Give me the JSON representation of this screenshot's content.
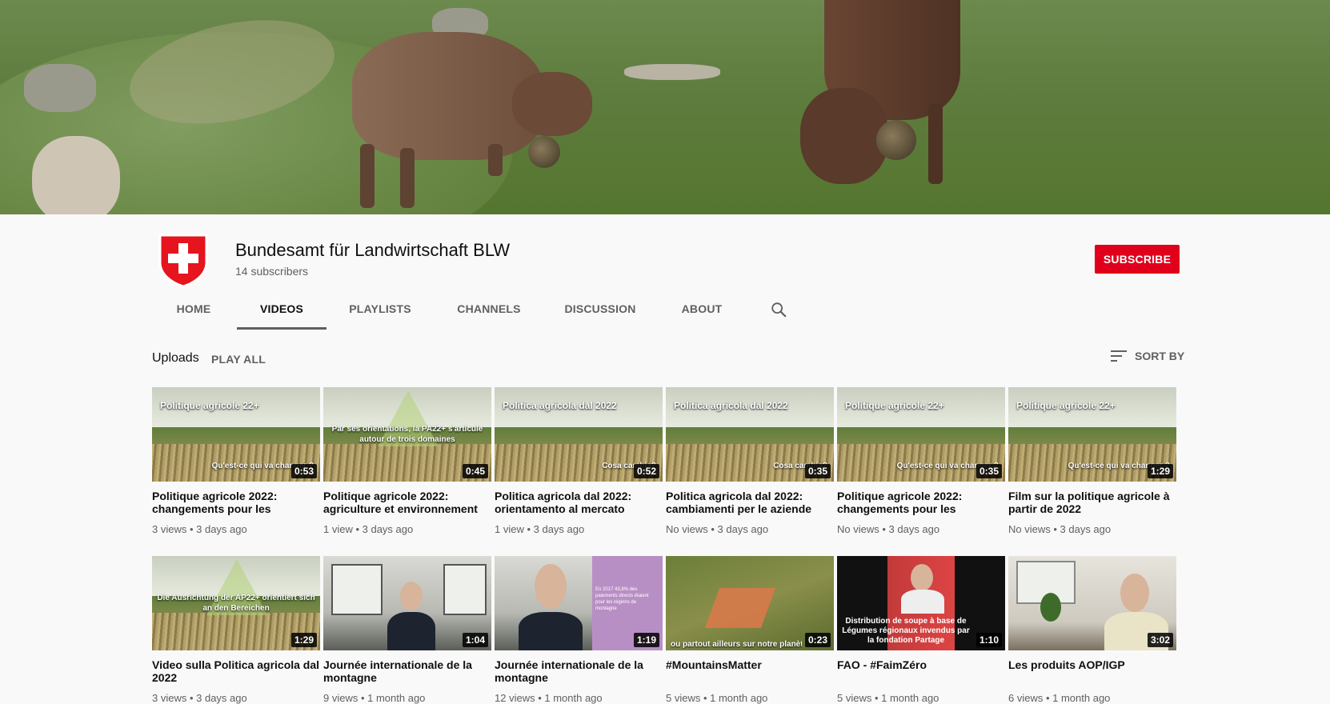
{
  "channel": {
    "name": "Bundesamt für Landwirtschaft BLW",
    "subscribers": "14 subscribers",
    "subscribe_label": "SUBSCRIBE",
    "accent_color": "#e0001b"
  },
  "tabs": [
    "HOME",
    "VIDEOS",
    "PLAYLISTS",
    "CHANNELS",
    "DISCUSSION",
    "ABOUT"
  ],
  "active_tab": "VIDEOS",
  "section": {
    "title": "Uploads",
    "play_all": "PLAY ALL",
    "sort_by": "SORT BY"
  },
  "videos": [
    {
      "title": "Politique agricole 2022: changements pour les",
      "meta": "3 views • 3 days ago",
      "duration": "0:53",
      "overlay_top": "Politique agricole 22+",
      "overlay_bottom": "Qu'est-ce qui va changer ?"
    },
    {
      "title": "Politique agricole 2022: agriculture et environnement",
      "meta": "1 view • 3 days ago",
      "duration": "0:45",
      "overlay_center": "Par ses orientations, la PA22+ s'articule autour de trois domaines"
    },
    {
      "title": "Politica agricola dal 2022: orientamento al mercato",
      "meta": "1 view • 3 days ago",
      "duration": "0:52",
      "overlay_top": "Politica agricola dal 2022",
      "overlay_bottom": "Cosa cambia?"
    },
    {
      "title": "Politica agricola dal 2022: cambiamenti per le aziende",
      "meta": "No views • 3 days ago",
      "duration": "0:35",
      "overlay_top": "Politica agricola dal 2022",
      "overlay_bottom": "Cosa cambia?"
    },
    {
      "title": "Politique agricole 2022: changements pour les",
      "meta": "No views • 3 days ago",
      "duration": "0:35",
      "overlay_top": "Politique agricole 22+",
      "overlay_bottom": "Qu'est-ce qui va changer ?"
    },
    {
      "title": "Film sur la politique agricole à partir de 2022",
      "meta": "No views • 3 days ago",
      "duration": "1:29",
      "overlay_top": "Politique agricole 22+",
      "overlay_bottom": "Qu'est-ce qui va changer ?"
    },
    {
      "title": "Video sulla Politica agricola dal 2022",
      "meta": "3 views • 3 days ago",
      "duration": "1:29",
      "overlay_center": "Die Ausrichtung der AP22+ orientiert sich an den Bereichen"
    },
    {
      "title": "Journée internationale de la montagne",
      "meta": "9 views • 1 month ago",
      "duration": "1:04"
    },
    {
      "title": "Journée internationale de la montagne",
      "meta": "12 views • 1 month ago",
      "duration": "1:19",
      "overlay_side": "En 2017 43,8% des paiements directs étaient pour les régions de montagne"
    },
    {
      "title": "#MountainsMatter",
      "meta": "5 views • 1 month ago",
      "duration": "0:23",
      "overlay_bottom": "ou partout ailleurs sur notre planète"
    },
    {
      "title": "FAO - #FaimZéro",
      "meta": "5 views • 1 month ago",
      "duration": "1:10",
      "overlay_bottom": "Distribution de soupe à base de Légumes régionaux invendus par la fondation Partage"
    },
    {
      "title": "Les produits AOP/IGP",
      "meta": "6 views • 1 month ago",
      "duration": "3:02"
    }
  ]
}
